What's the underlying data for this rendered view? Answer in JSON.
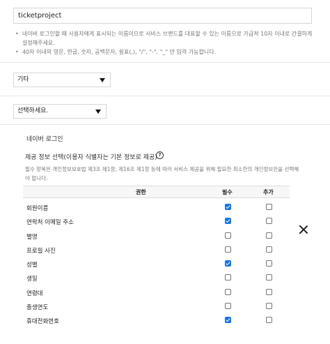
{
  "service_name": {
    "value": "ticketproject",
    "notes": [
      "네이버 로그인할 때 사용자에게 표시되는 이름이므로 서비스 브랜드를 대표할 수 있는 이름으로 가급적 10자 이내로 간결하게 설정해주세요.",
      "40자 이내의 영문, 한글, 숫자, 공백문자, 쉼표(,), \"/\", \"-\", \"_\" 만 입력 가능합니다."
    ]
  },
  "category_select": {
    "value": "기타"
  },
  "api_select": {
    "value": "선택하세요."
  },
  "naver_login": {
    "title": "네이버 로그인",
    "provide_title": "제공 정보 선택(이용자 식별자는 기본 정보로 제공)",
    "help_icon": "?",
    "description": "필수 항목은 개인정보보호법 제3조 제1항, 제16조 제1항 등에 따라 서비스 제공을 위해 필요한 최소한의 개인정보만을 선택해야 합니다.",
    "table": {
      "headers": {
        "permission": "권한",
        "required": "필수",
        "additional": "추가"
      },
      "rows": [
        {
          "label": "회원이름",
          "required": true,
          "additional": false
        },
        {
          "label": "연락처 이메일 주소",
          "required": true,
          "additional": false
        },
        {
          "label": "별명",
          "required": false,
          "additional": false
        },
        {
          "label": "프로필 사진",
          "required": false,
          "additional": false
        },
        {
          "label": "성별",
          "required": true,
          "additional": false
        },
        {
          "label": "생일",
          "required": false,
          "additional": false
        },
        {
          "label": "연령대",
          "required": false,
          "additional": false
        },
        {
          "label": "출생연도",
          "required": false,
          "additional": false
        },
        {
          "label": "휴대전화번호",
          "required": true,
          "additional": false
        }
      ]
    }
  },
  "icons": {
    "close": "close-icon",
    "dropdown": "chevron-down-icon",
    "help": "help-icon"
  },
  "colors": {
    "checked": "#1a73e8"
  }
}
